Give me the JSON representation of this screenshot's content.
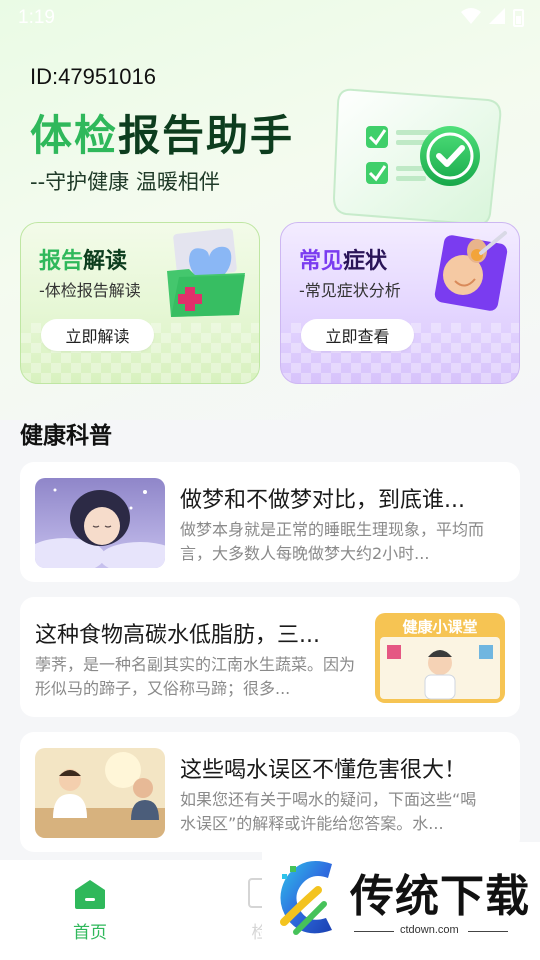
{
  "status_bar": {
    "time": "1:19"
  },
  "header": {
    "user_id": "ID:47951016",
    "title_part1": "体检",
    "title_part2": "报告助手",
    "slogan": "--守护健康 温暖相伴"
  },
  "cards": [
    {
      "title_a": "报告",
      "title_b": "解读",
      "subtitle": "-体检报告解读",
      "button": "立即解读"
    },
    {
      "title_a": "常见",
      "title_b": "症状",
      "subtitle": "-常见症状分析",
      "button": "立即查看"
    }
  ],
  "section": {
    "title": "健康科普"
  },
  "articles": [
    {
      "title": "做梦和不做梦对比，到底谁...",
      "desc": "做梦本身就是正常的睡眠生理现象，平均而言，大多数人每晚做梦大约2小时..."
    },
    {
      "title": "这种食物高碳水低脂肪，三...",
      "desc": "荸荠，是一种名副其实的江南水生蔬菜。因为形似马的蹄子，又俗称马蹄；很多...",
      "thumb_text": "健康小课堂"
    },
    {
      "title": "这些喝水误区不懂危害很大！",
      "desc": "如果您还有关于喝水的疑问，下面这些“喝水误区”的解释或许能给您答案。水..."
    }
  ],
  "bottom_nav": {
    "home": "首页",
    "second": "检"
  },
  "watermark": {
    "brand": "传统下载",
    "url": "ctdown.com"
  },
  "colors": {
    "primary_green": "#2fb85b",
    "purple": "#7a3cf0"
  }
}
